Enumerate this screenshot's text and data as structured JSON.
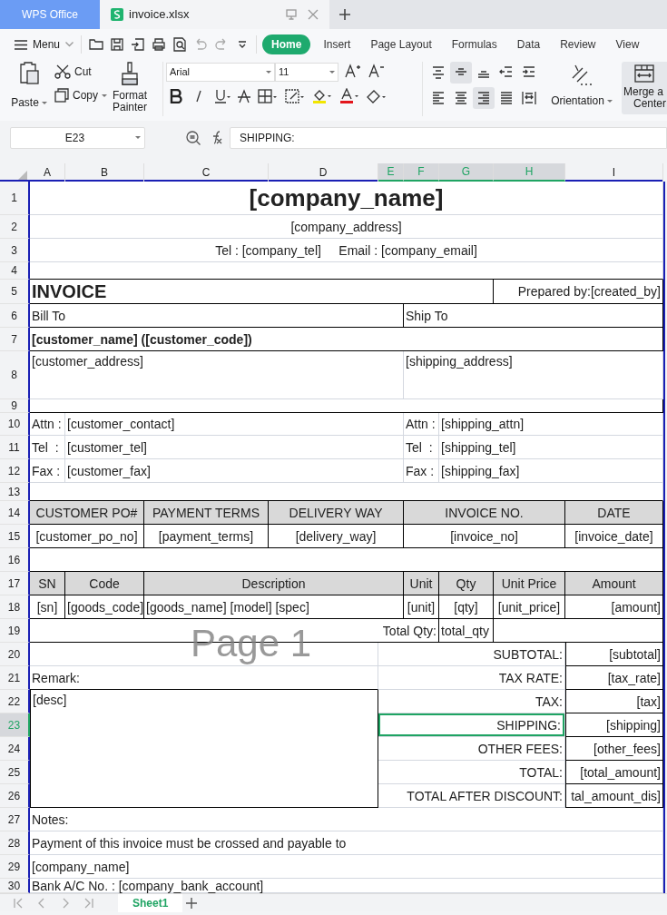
{
  "app_tab": {
    "label": "WPS Office"
  },
  "doc_tab": {
    "title": "invoice.xlsx"
  },
  "menu": {
    "label": "Menu"
  },
  "ribbon_tabs": [
    {
      "label": "Home",
      "selected": true
    },
    {
      "label": "Insert",
      "selected": false
    },
    {
      "label": "Page Layout",
      "selected": false
    },
    {
      "label": "Formulas",
      "selected": false
    },
    {
      "label": "Data",
      "selected": false
    },
    {
      "label": "Review",
      "selected": false
    },
    {
      "label": "View",
      "selected": false
    }
  ],
  "ribbon": {
    "paste": "Paste",
    "cut": "Cut",
    "copy": "Copy",
    "format_painter": [
      "Format",
      "Painter"
    ],
    "font": "Arial",
    "font_size": "11",
    "orientation": "Orientation",
    "merge": [
      "Merge a",
      "Center"
    ]
  },
  "align_buttons": [
    {
      "kind": "top",
      "selected": false
    },
    {
      "kind": "middle",
      "selected": true
    },
    {
      "kind": "bottom",
      "selected": false
    },
    {
      "kind": "outdent",
      "selected": false
    },
    {
      "kind": "indent",
      "selected": false
    },
    {
      "kind": "left",
      "selected": false
    },
    {
      "kind": "center",
      "selected": false
    },
    {
      "kind": "right",
      "selected": true
    },
    {
      "kind": "justify",
      "selected": false
    },
    {
      "kind": "distributed",
      "selected": false
    }
  ],
  "name_box": "E23",
  "formula": "SHIPPING:",
  "columns": [
    {
      "label": "A",
      "selected": false
    },
    {
      "label": "B",
      "selected": false
    },
    {
      "label": "C",
      "selected": false
    },
    {
      "label": "D",
      "selected": false
    },
    {
      "label": "E",
      "selected": true
    },
    {
      "label": "F",
      "selected": true
    },
    {
      "label": "G",
      "selected": true
    },
    {
      "label": "H",
      "selected": true
    },
    {
      "label": "I",
      "selected": false
    }
  ],
  "rows": [
    {
      "number": "1",
      "selected": false,
      "cells": [
        {
          "text": "[company_name]",
          "selected": false
        }
      ]
    },
    {
      "number": "2",
      "selected": false,
      "cells": [
        {
          "text": "[company_address]",
          "selected": false
        }
      ]
    },
    {
      "number": "3",
      "selected": false,
      "cells": [
        {
          "text": "Tel : [company_tel]     Email : [company_email]",
          "selected": false
        }
      ]
    },
    {
      "number": "4",
      "selected": false
    },
    {
      "number": "5",
      "selected": false,
      "cells": [
        {
          "text": "INVOICE",
          "selected": false
        },
        {
          "text": "Prepared by:[created_by]",
          "selected": false
        }
      ]
    },
    {
      "number": "6",
      "selected": false,
      "cells": [
        {
          "text": "Bill To",
          "selected": false
        },
        {
          "text": "Ship To",
          "selected": false
        }
      ]
    },
    {
      "number": "7",
      "selected": false,
      "cells": [
        {
          "text": "[customer_name] ([customer_code])",
          "selected": false
        }
      ]
    },
    {
      "number": "8",
      "selected": false,
      "cells": [
        {
          "text": "[customer_address]",
          "selected": false
        },
        {
          "text": "[shipping_address]",
          "selected": false
        }
      ]
    },
    {
      "number": "9",
      "selected": false
    },
    {
      "number": "10",
      "selected": false,
      "cells": [
        {
          "text": "Attn :",
          "selected": false
        },
        {
          "text": "[customer_contact]",
          "selected": false
        },
        {
          "text": "Attn :",
          "selected": false
        },
        {
          "text": "[shipping_attn]",
          "selected": false
        }
      ]
    },
    {
      "number": "11",
      "selected": false,
      "cells": [
        {
          "text": "Tel  :",
          "selected": false
        },
        {
          "text": "[customer_tel]",
          "selected": false
        },
        {
          "text": "Tel  :",
          "selected": false
        },
        {
          "text": "[shipping_tel]",
          "selected": false
        }
      ]
    },
    {
      "number": "12",
      "selected": false,
      "cells": [
        {
          "text": "Fax :",
          "selected": false
        },
        {
          "text": "[customer_fax]",
          "selected": false
        },
        {
          "text": "Fax :",
          "selected": false
        },
        {
          "text": "[shipping_fax]",
          "selected": false
        }
      ]
    },
    {
      "number": "13",
      "selected": false
    },
    {
      "number": "14",
      "selected": false,
      "cells": [
        {
          "text": "CUSTOMER PO#",
          "selected": false
        },
        {
          "text": "PAYMENT TERMS",
          "selected": false
        },
        {
          "text": "DELIVERY WAY",
          "selected": false
        },
        {
          "text": "INVOICE NO.",
          "selected": false
        },
        {
          "text": "DATE",
          "selected": false
        }
      ]
    },
    {
      "number": "15",
      "selected": false,
      "cells": [
        {
          "text": "[customer_po_no]",
          "selected": false
        },
        {
          "text": "[payment_terms]",
          "selected": false
        },
        {
          "text": "[delivery_way]",
          "selected": false
        },
        {
          "text": "[invoice_no]",
          "selected": false
        },
        {
          "text": "[invoice_date]",
          "selected": false
        }
      ]
    },
    {
      "number": "16",
      "selected": false
    },
    {
      "number": "17",
      "selected": false,
      "cells": [
        {
          "text": "SN",
          "selected": false
        },
        {
          "text": "Code",
          "selected": false
        },
        {
          "text": "Description",
          "selected": false
        },
        {
          "text": "Unit",
          "selected": false
        },
        {
          "text": "Qty",
          "selected": false
        },
        {
          "text": "Unit Price",
          "selected": false
        },
        {
          "text": "Amount",
          "selected": false
        }
      ]
    },
    {
      "number": "18",
      "selected": false,
      "cells": [
        {
          "text": "[sn]",
          "selected": false
        },
        {
          "text": "[goods_code]",
          "selected": false
        },
        {
          "text": "[goods_name] [model] [spec]",
          "selected": false
        },
        {
          "text": "[unit]",
          "selected": false
        },
        {
          "text": "[qty]",
          "selected": false
        },
        {
          "text": "[unit_price]",
          "selected": false
        },
        {
          "text": "[amount]",
          "selected": false
        }
      ]
    },
    {
      "number": "19",
      "selected": false,
      "cells": [
        {
          "text": "Total Qty:",
          "selected": false
        },
        {
          "text": "total_qty",
          "selected": false
        }
      ]
    },
    {
      "number": "20",
      "selected": false,
      "cells": [
        {
          "text": "SUBTOTAL:",
          "selected": false
        },
        {
          "text": "[subtotal]",
          "selected": false
        }
      ]
    },
    {
      "number": "21",
      "selected": false,
      "cells": [
        {
          "text": "Remark:",
          "selected": false
        },
        {
          "text": "TAX RATE:",
          "selected": false
        },
        {
          "text": "[tax_rate]",
          "selected": false
        }
      ]
    },
    {
      "number": "22",
      "selected": false,
      "cells": [
        {
          "text": "[desc]",
          "selected": false
        },
        {
          "text": "TAX:",
          "selected": false
        },
        {
          "text": "[tax]",
          "selected": false
        }
      ]
    },
    {
      "number": "23",
      "selected": true,
      "cells": [
        {
          "text": "SHIPPING:",
          "selected": true
        },
        {
          "text": "[shipping]",
          "selected": false
        }
      ]
    },
    {
      "number": "24",
      "selected": false,
      "cells": [
        {
          "text": "OTHER FEES:",
          "selected": false
        },
        {
          "text": "[other_fees]",
          "selected": false
        }
      ]
    },
    {
      "number": "25",
      "selected": false,
      "cells": [
        {
          "text": "TOTAL:",
          "selected": false
        },
        {
          "text": "[total_amount]",
          "selected": false
        }
      ]
    },
    {
      "number": "26",
      "selected": false,
      "cells": [
        {
          "text": "TOTAL AFTER DISCOUNT:",
          "selected": false
        },
        {
          "text": "tal_amount_dis]",
          "selected": false
        }
      ]
    },
    {
      "number": "27",
      "selected": false,
      "cells": [
        {
          "text": "Notes:",
          "selected": false
        }
      ]
    },
    {
      "number": "28",
      "selected": false,
      "cells": [
        {
          "text": "Payment of this invoice must be crossed and payable to",
          "selected": false
        }
      ]
    },
    {
      "number": "29",
      "selected": false,
      "cells": [
        {
          "text": "[company_name]",
          "selected": false
        }
      ]
    },
    {
      "number": "30",
      "selected": false,
      "cells": [
        {
          "text": "Bank A/C No. : [company_bank_account]",
          "selected": false
        }
      ]
    }
  ],
  "page_label": "Page 1",
  "sheet_tabs": [
    {
      "label": "Sheet1",
      "selected": true
    }
  ]
}
